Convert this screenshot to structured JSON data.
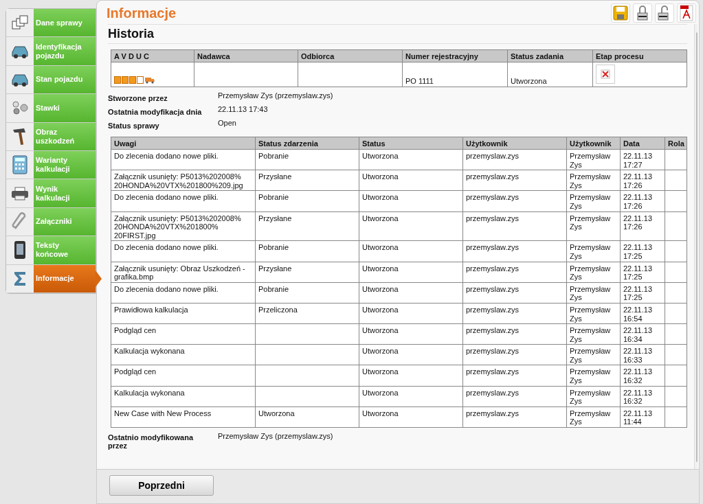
{
  "sidebar": {
    "items": [
      {
        "label": "Dane sprawy",
        "selected": false
      },
      {
        "label": "Identyfikacja pojazdu",
        "selected": false
      },
      {
        "label": "Stan pojazdu",
        "selected": false
      },
      {
        "label": "Stawki",
        "selected": false
      },
      {
        "label": "Obraz uszkodzeń",
        "selected": false
      },
      {
        "label": "Warianty kalkulacji",
        "selected": false
      },
      {
        "label": "Wynik kalkulacji",
        "selected": false
      },
      {
        "label": "Załączniki",
        "selected": false
      },
      {
        "label": "Teksty końcowe",
        "selected": false
      },
      {
        "label": "Informacje",
        "selected": true
      }
    ]
  },
  "page_title": "Informacje",
  "section_title": "Historia",
  "case_table": {
    "columns": [
      "A V D U C",
      "Nadawca",
      "Odbiorca",
      "Numer rejestracyjny",
      "Status zadania",
      "Etap procesu"
    ],
    "row": {
      "avduc": [
        {
          "filled": true
        },
        {
          "filled": true
        },
        {
          "filled": true
        },
        {
          "filled": false
        }
      ],
      "registration": "PO 1111",
      "task_status": "Utworzona"
    }
  },
  "details": [
    {
      "label": "Stworzone przez",
      "value": "Przemysław Zys (przemyslaw.zys)"
    },
    {
      "label": "Ostatnia modyfikacja dnia",
      "value": "22.11.13 17:43"
    },
    {
      "label": "Status sprawy",
      "value": "Open"
    }
  ],
  "history_table": {
    "columns": [
      "Uwagi",
      "Status zdarzenia",
      "Status",
      "Użytkownik",
      "Użytkownik",
      "Data",
      "Rola"
    ],
    "rows": [
      [
        "Do zlecenia dodano nowe pliki.",
        "Pobranie",
        "Utworzona",
        "przemyslaw.zys",
        "Przemysław Zys",
        "22.11.13 17:27",
        ""
      ],
      [
        "Załącznik usunięty: P5013%202008% 20HONDA%20VTX%201800%209.jpg",
        "Przysłane",
        "Utworzona",
        "przemyslaw.zys",
        "Przemysław Zys",
        "22.11.13 17:26",
        ""
      ],
      [
        "Do zlecenia dodano nowe pliki.",
        "Pobranie",
        "Utworzona",
        "przemyslaw.zys",
        "Przemysław Zys",
        "22.11.13 17:26",
        ""
      ],
      [
        "Załącznik usunięty: P5013%202008% 20HONDA%20VTX%201800% 20FIRST.jpg",
        "Przysłane",
        "Utworzona",
        "przemyslaw.zys",
        "Przemysław Zys",
        "22.11.13 17:26",
        ""
      ],
      [
        "Do zlecenia dodano nowe pliki.",
        "Pobranie",
        "Utworzona",
        "przemyslaw.zys",
        "Przemysław Zys",
        "22.11.13 17:25",
        ""
      ],
      [
        "Załącznik usunięty: Obraz Uszkodzeń - grafika.bmp",
        "Przysłane",
        "Utworzona",
        "przemyslaw.zys",
        "Przemysław Zys",
        "22.11.13 17:25",
        ""
      ],
      [
        "Do zlecenia dodano nowe pliki.",
        "Pobranie",
        "Utworzona",
        "przemyslaw.zys",
        "Przemysław Zys",
        "22.11.13 17:25",
        ""
      ],
      [
        "Prawidłowa kalkulacja",
        "Przeliczona",
        "Utworzona",
        "przemyslaw.zys",
        "Przemysław Zys",
        "22.11.13 16:54",
        ""
      ],
      [
        "Podgląd cen",
        "",
        "Utworzona",
        "przemyslaw.zys",
        "Przemysław Zys",
        "22.11.13 16:34",
        ""
      ],
      [
        "Kalkulacja wykonana",
        "",
        "Utworzona",
        "przemyslaw.zys",
        "Przemysław Zys",
        "22.11.13 16:33",
        ""
      ],
      [
        "Podgląd cen",
        "",
        "Utworzona",
        "przemyslaw.zys",
        "Przemysław Zys",
        "22.11.13 16:32",
        ""
      ],
      [
        "Kalkulacja wykonana",
        "",
        "Utworzona",
        "przemyslaw.zys",
        "Przemysław Zys",
        "22.11.13 16:32",
        ""
      ],
      [
        "New Case with New Process",
        "Utworzona",
        "Utworzona",
        "przemyslaw.zys",
        "Przemysław Zys",
        "22.11.13 11:44",
        ""
      ]
    ]
  },
  "footer_detail": {
    "label": "Ostatnio modyfikowana przez",
    "value": "Przemysław Zys (przemyslaw.zys)"
  },
  "back_button": "Poprzedni"
}
